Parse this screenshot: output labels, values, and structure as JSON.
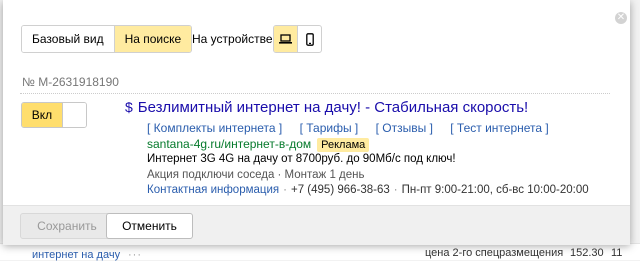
{
  "view_switch": {
    "items": [
      "Базовый вид",
      "На поиске"
    ],
    "active_index": 1,
    "device_label": "На устройстве",
    "devices": [
      "laptop-icon",
      "phone-icon"
    ],
    "active_device": 0
  },
  "order_id": "№ M-2631918190",
  "toggle": {
    "label": "Вкл",
    "state": "on"
  },
  "ad": {
    "title": "Безлимитный интернет на дачу! - Стабильная скорость!",
    "sitelinks": [
      "[ Комплекты интернета ]",
      "[ Тарифы ]",
      "[ Отзывы ]",
      "[ Тест интернета ]"
    ],
    "url": "santana-4g.ru/интернет-в-дом",
    "badge": "Реклама",
    "text": "Интернет 3G 4G на дачу от 8700руб. до 90Мб/с под ключ!",
    "extension": "Акция подключи соседа · Монтаж 1 день",
    "contact_link": "Контактная информация",
    "phone": "+7 (495) 966-38-63",
    "hours": "Пн-пт 9:00-21:00, сб-вс 10:00-20:00"
  },
  "buttons": {
    "save": "Сохранить",
    "cancel": "Отменить"
  },
  "background": {
    "link": "интернет на дачу",
    "dots": "···",
    "text": "цена 2-го спецразмещения",
    "value": "152.30",
    "value2": "11"
  },
  "colors": {
    "accent_yellow": "#ffeba0",
    "toggle_yellow": "#ffde6d",
    "link_blue": "#2a5dad",
    "url_green": "#067a2c"
  }
}
